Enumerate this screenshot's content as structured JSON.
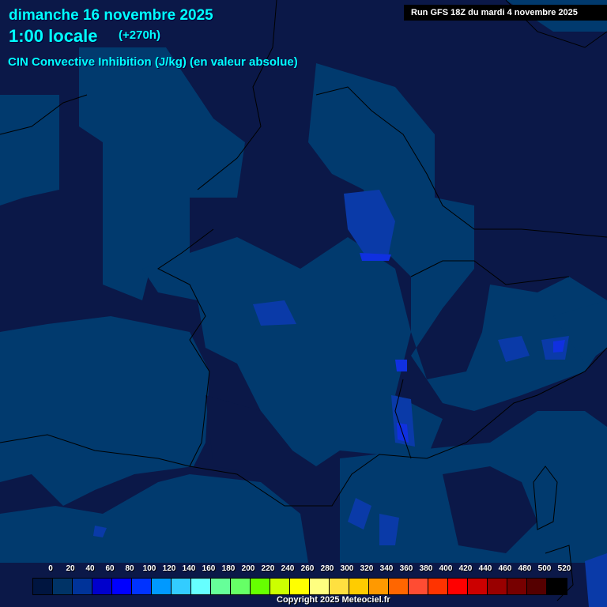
{
  "header": {
    "date": "dimanche 16 novembre 2025",
    "hour": "1:00 locale",
    "lead": "(+270h)",
    "parameter": "CIN Convective Inhibition (J/kg) (en valeur absolue)",
    "run": "Run GFS 18Z du mardi 4 novembre 2025"
  },
  "legend": {
    "labels": [
      "0",
      "20",
      "40",
      "60",
      "80",
      "100",
      "120",
      "140",
      "160",
      "180",
      "200",
      "220",
      "240",
      "260",
      "280",
      "300",
      "320",
      "340",
      "360",
      "380",
      "400",
      "420",
      "440",
      "460",
      "480",
      "500",
      "520"
    ],
    "colors": [
      "#001540",
      "#003366",
      "#003399",
      "#0000cc",
      "#0000ff",
      "#0033ff",
      "#0099ff",
      "#33ccff",
      "#66ffff",
      "#66ff99",
      "#66ff66",
      "#66ff00",
      "#ccff00",
      "#ffff00",
      "#ffff80",
      "#ffe040",
      "#ffcc00",
      "#ff9900",
      "#ff6600",
      "#ff4c33",
      "#ff3300",
      "#ff0000",
      "#cc0000",
      "#990000",
      "#770000",
      "#550000",
      "#000000"
    ]
  },
  "copyright": "Copyright 2025 Meteociel.fr"
}
